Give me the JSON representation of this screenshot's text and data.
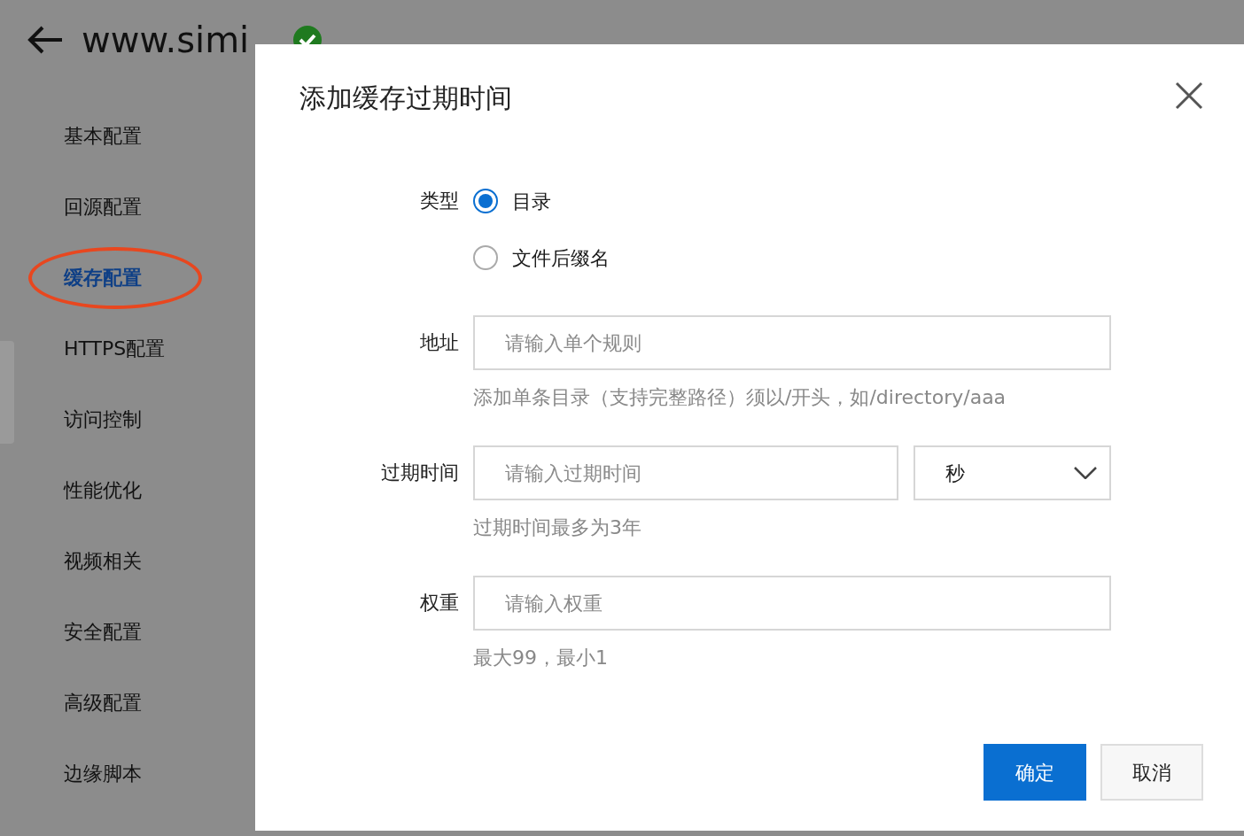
{
  "header": {
    "title": "www.simi"
  },
  "sidebar": {
    "items": [
      {
        "label": "基本配置",
        "selected": false,
        "circled": false
      },
      {
        "label": "回源配置",
        "selected": false,
        "circled": false
      },
      {
        "label": "缓存配置",
        "selected": true,
        "circled": true
      },
      {
        "label": "HTTPS配置",
        "selected": false,
        "circled": false
      },
      {
        "label": "访问控制",
        "selected": false,
        "circled": false
      },
      {
        "label": "性能优化",
        "selected": false,
        "circled": false
      },
      {
        "label": "视频相关",
        "selected": false,
        "circled": false
      },
      {
        "label": "安全配置",
        "selected": false,
        "circled": false
      },
      {
        "label": "高级配置",
        "selected": false,
        "circled": false
      },
      {
        "label": "边缘脚本",
        "selected": false,
        "circled": false
      }
    ]
  },
  "dialog": {
    "title": "添加缓存过期时间",
    "fields": [
      {
        "kind": "radio",
        "label": "类型",
        "options": [
          {
            "label": "目录",
            "selected": true
          },
          {
            "label": "文件后缀名",
            "selected": false
          }
        ]
      },
      {
        "kind": "input",
        "label": "地址",
        "placeholder": "请输入单个规则",
        "help": "添加单条目录（支持完整路径）须以/开头，如/directory/aaa"
      },
      {
        "kind": "input_select",
        "label": "过期时间",
        "placeholder": "请输入过期时间",
        "unit": "秒",
        "help": "过期时间最多为3年"
      },
      {
        "kind": "input",
        "label": "权重",
        "placeholder": "请输入权重",
        "help": "最大99，最小1"
      }
    ],
    "buttons": [
      {
        "label": "确定",
        "kind": "primary"
      },
      {
        "label": "取消",
        "kind": "secondary"
      }
    ]
  }
}
